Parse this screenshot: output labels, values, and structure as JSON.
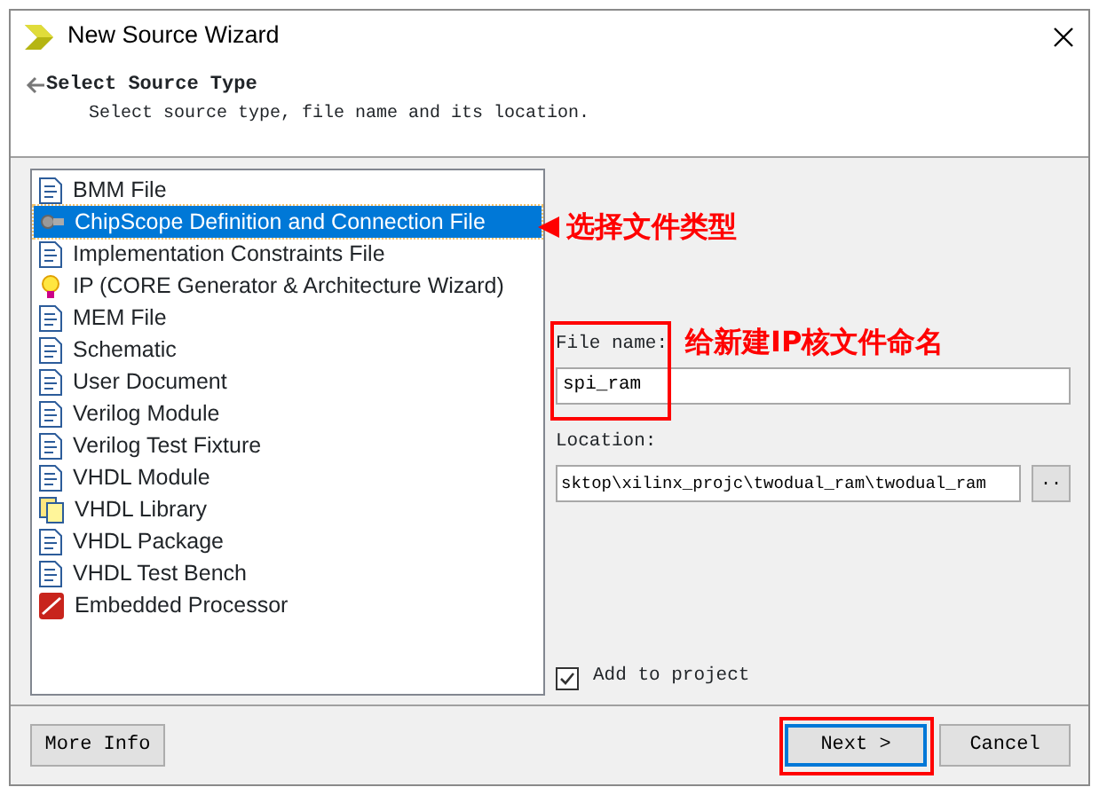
{
  "window": {
    "title": "New Source Wizard"
  },
  "header": {
    "title": "Select Source Type",
    "subtitle": "Select source type, file name and its location."
  },
  "source_types": [
    {
      "label": "BMM File",
      "kind": "document",
      "selected": false
    },
    {
      "label": "ChipScope Definition and Connection File",
      "kind": "probe",
      "selected": true
    },
    {
      "label": "Implementation Constraints File",
      "kind": "document",
      "selected": false
    },
    {
      "label": "IP (CORE Generator & Architecture Wizard)",
      "kind": "bulb",
      "selected": false
    },
    {
      "label": "MEM File",
      "kind": "document",
      "selected": false
    },
    {
      "label": "Schematic",
      "kind": "document",
      "selected": false
    },
    {
      "label": "User Document",
      "kind": "document",
      "selected": false
    },
    {
      "label": "Verilog Module",
      "kind": "document",
      "selected": false
    },
    {
      "label": "Verilog Test Fixture",
      "kind": "document",
      "selected": false
    },
    {
      "label": "VHDL Module",
      "kind": "document",
      "selected": false
    },
    {
      "label": "VHDL Library",
      "kind": "library",
      "selected": false
    },
    {
      "label": "VHDL Package",
      "kind": "document",
      "selected": false
    },
    {
      "label": "VHDL Test Bench",
      "kind": "document",
      "selected": false
    },
    {
      "label": "Embedded Processor",
      "kind": "processor",
      "selected": false
    }
  ],
  "file_name": {
    "label": "File name:",
    "value": "spi_ram"
  },
  "location": {
    "label": "Location:",
    "value": "sktop\\xilinx_projc\\twodual_ram\\twodual_ram",
    "browse": ".."
  },
  "add_to_project": {
    "label": "Add to project",
    "checked": true
  },
  "buttons": [
    {
      "label": "More Info",
      "focused": false
    },
    {
      "label": "Next >",
      "focused": true
    },
    {
      "label": "Cancel",
      "focused": false
    }
  ],
  "annotations": [
    {
      "kind": "arrow-label",
      "text": "选择文件类型"
    },
    {
      "kind": "box"
    },
    {
      "kind": "label",
      "text": "给新建IP核文件命名"
    },
    {
      "kind": "box"
    }
  ]
}
